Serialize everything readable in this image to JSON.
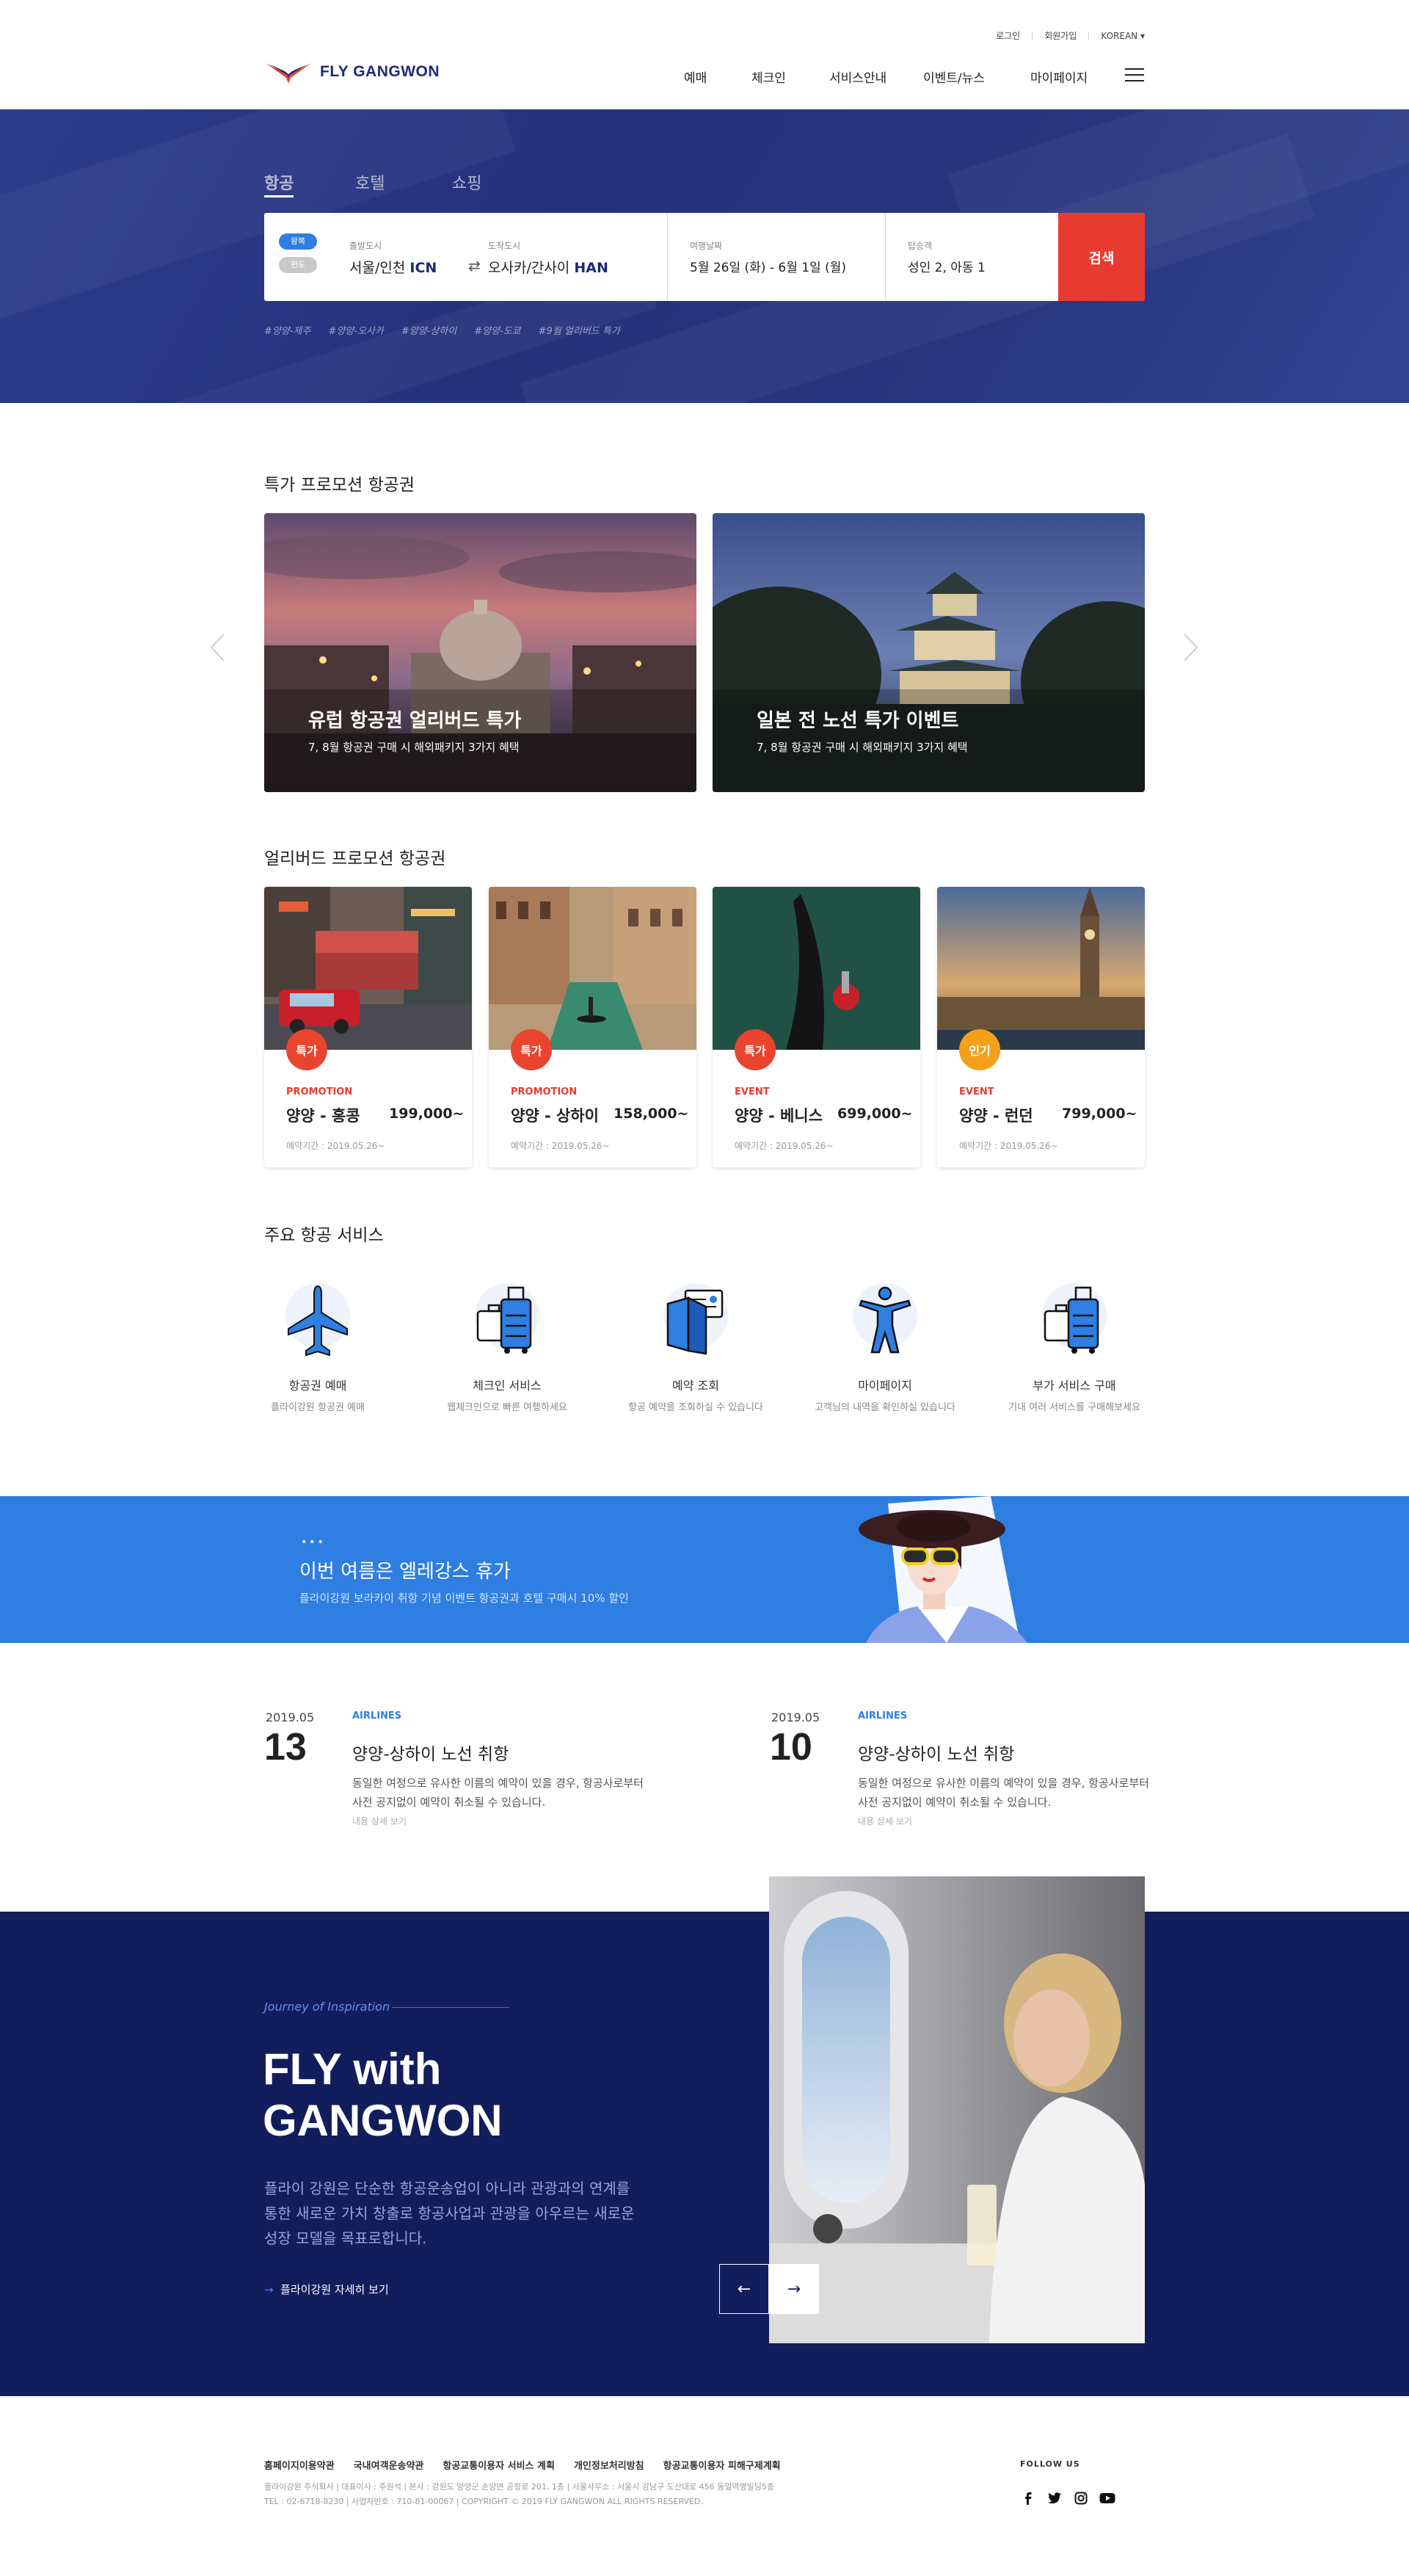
{
  "header": {
    "util": [
      "로그인",
      "회원가입",
      "KOREAN"
    ],
    "logo_text": "FLY GANGWON",
    "nav": [
      "예매",
      "체크인",
      "서비스안내",
      "이벤트/뉴스",
      "마이페이지"
    ]
  },
  "hero": {
    "tabs": [
      "항공",
      "호텔",
      "쇼핑"
    ],
    "trip_types": [
      "왕복",
      "편도"
    ],
    "from_label": "출발도시",
    "from_value": "서울/인천",
    "from_code": "ICN",
    "to_label": "도착도시",
    "to_value": "오사카/간사이",
    "to_code": "HAN",
    "date_label": "여행날짜",
    "date_value": "5월 26일 (화) - 6월 1일 (월)",
    "pax_label": "탑승객",
    "pax_value": "성인 2, 아동 1",
    "search_button": "검색",
    "tags": [
      "#양양-제주",
      "#양양-오사카",
      "#양양-상하이",
      "#양양-도쿄",
      "#9월 얼리버드 특가"
    ]
  },
  "special": {
    "title": "특가 프로모션 항공권",
    "items": [
      {
        "title": "유럽 항공권 얼리버드 특가",
        "desc": "7, 8월 항공권 구매 시 해외패키지 3가지 혜택"
      },
      {
        "title": "일본 전 노선 특가 이벤트",
        "desc": "7, 8월 항공권 구매 시 해외패키지 3가지 혜택"
      }
    ]
  },
  "earlybird": {
    "title": "얼리버드 프로모션 항공권",
    "cards": [
      {
        "badge": "특가",
        "badge_color": "#e8442e",
        "type": "PROMOTION",
        "route": "양양 - 홍콩",
        "price": "199,000~",
        "date": "예약기간 : 2019.05.26~"
      },
      {
        "badge": "특가",
        "badge_color": "#e8442e",
        "type": "PROMOTION",
        "route": "양양 - 상하이",
        "price": "158,000~",
        "date": "예약기간 : 2019.05.26~"
      },
      {
        "badge": "특가",
        "badge_color": "#e8442e",
        "type": "EVENT",
        "route": "양양 - 베니스",
        "price": "699,000~",
        "date": "예약기간 : 2019.05.26~"
      },
      {
        "badge": "인기",
        "badge_color": "#f5a01a",
        "type": "EVENT",
        "route": "양양 - 런던",
        "price": "799,000~",
        "date": "예약기간 : 2019.05.26~"
      }
    ]
  },
  "services": {
    "title": "주요 항공 서비스",
    "items": [
      {
        "icon": "airplane-icon",
        "title": "항공권 예매",
        "desc": "플라이강원 항공권 예매"
      },
      {
        "icon": "luggage-icon",
        "title": "체크인 서비스",
        "desc": "웹체크인으로 빠른 여행하세요"
      },
      {
        "icon": "ticket-icon",
        "title": "예약 조회",
        "desc": "항공 예약을 조회하실 수 있습니다"
      },
      {
        "icon": "person-icon",
        "title": "마이페이지",
        "desc": "고객님의 내역을 확인하실 있습니다"
      },
      {
        "icon": "luggage-icon",
        "title": "부가 서비스 구매",
        "desc": "기내 여러 서비스를 구매해보세요"
      }
    ]
  },
  "banner": {
    "dots": "•••",
    "title": "이번 여름은 엘레강스 휴가",
    "desc": "플라이강원 보라카이 취항 기념 이벤트 항공권과 호텔 구매시 10% 할인"
  },
  "news": [
    {
      "ym": "2019.05",
      "day": "13",
      "category": "AIRLINES",
      "title": "양양-상하이 노선 취항",
      "body": "동일한 여정으로 유사한 이름의 예약이 있을 경우, 항공사로부터 사전 공지없이 예약이 취소될 수 있습니다.",
      "more": "내용 상세 보기"
    },
    {
      "ym": "2019.05",
      "day": "10",
      "category": "AIRLINES",
      "title": "양양-상하이 노선 취항",
      "body": "동일한 여정으로 유사한 이름의 예약이 있을 경우, 항공사로부터 사전 공지없이 예약이 취소될 수 있습니다.",
      "more": "내용 상세 보기"
    }
  ],
  "fly": {
    "kicker": "Journey of Inspiration",
    "line1_bold": "FLY",
    "line1_rest": " with",
    "line2": "GANGWON",
    "desc": "플라이 강원은 단순한 항공운송업이 아니라 관광과의 연계를 통한 새로운 가치 창출로 항공사업과 관광을 아우르는 새로운 성장 모델을 목표로합니다.",
    "link": "플라이강원 자세히 보기",
    "prev": "←",
    "next": "→"
  },
  "footer": {
    "links": [
      "홈페이지이용약관",
      "국내여객운송약관",
      "항공교통이용자 서비스 계획",
      "개인정보처리방침",
      "항공교통이용자 피해구제계획"
    ],
    "info1": "플라이강원 주식회사 | 대표이사 : 주원석 | 본사 : 강원도 양양군 손양면 공항로 201, 1층 | 서울사무소 : 서울시 강남구 도산대로 456 동일역명빌딩5층",
    "info2": "TEL : 02-6718-8230 | 사업자번호 : 710-81-00067 | COPYRIGHT © 2019 FLY GANGWON ALL RIGHTS RESERVED.",
    "follow": "FOLLOW US",
    "social": [
      "facebook-icon",
      "twitter-icon",
      "instagram-icon",
      "youtube-icon"
    ]
  }
}
